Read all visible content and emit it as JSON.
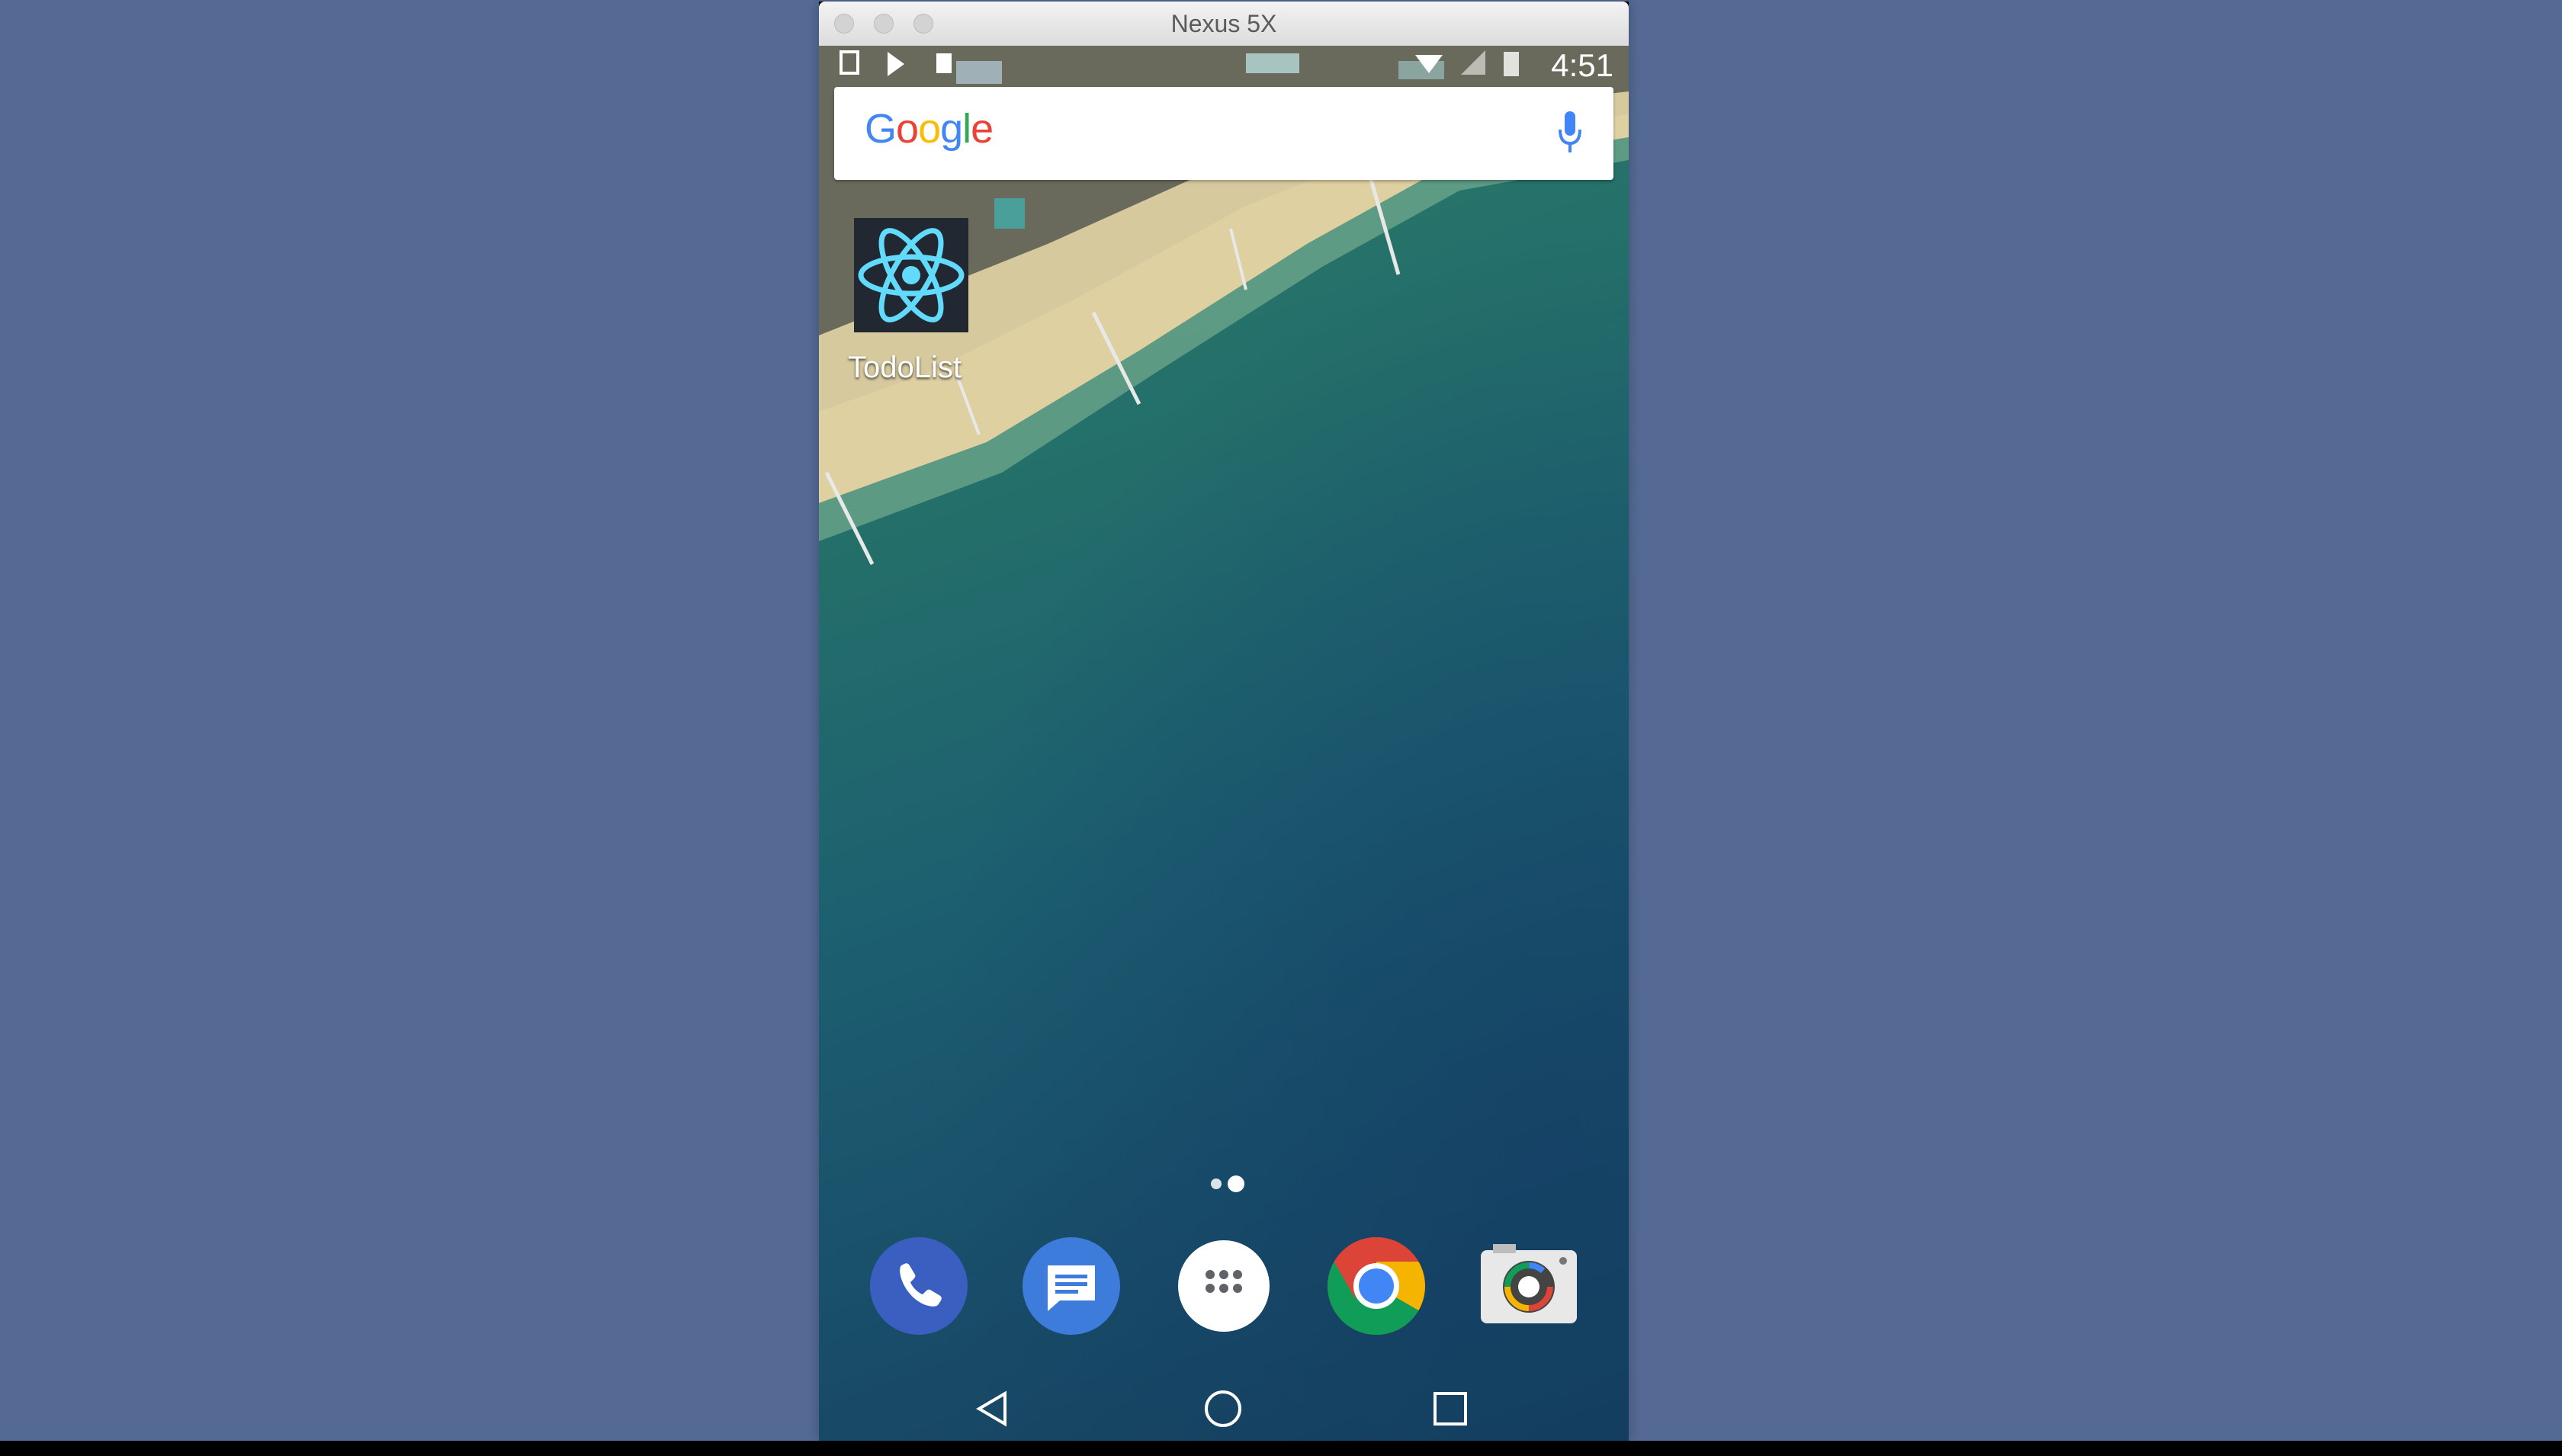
{
  "window": {
    "title": "Nexus 5X"
  },
  "status_bar": {
    "time": "4:51"
  },
  "search": {
    "logo": "Google",
    "mic_icon": "mic-icon"
  },
  "home": {
    "apps": [
      {
        "label": "TodoList",
        "icon": "react-atom-icon"
      }
    ]
  },
  "page_indicator": {
    "pages": 2,
    "current": 2
  },
  "dock": [
    {
      "name": "phone",
      "icon": "phone-icon",
      "color": "#3b5fc0"
    },
    {
      "name": "messages",
      "icon": "messages-icon",
      "color": "#3d7cdb"
    },
    {
      "name": "app-drawer",
      "icon": "grid-icon",
      "color": "#ffffff"
    },
    {
      "name": "chrome",
      "icon": "chrome-icon",
      "color": "#db4437"
    },
    {
      "name": "camera",
      "icon": "camera-icon",
      "color": "#e8e8e8"
    }
  ],
  "nav_bar": {
    "back": "back-icon",
    "home": "home-icon",
    "recents": "recents-icon"
  },
  "colors": {
    "desktop": "#546a94",
    "sea": "#1c5e70",
    "sand": "#d9c695"
  }
}
